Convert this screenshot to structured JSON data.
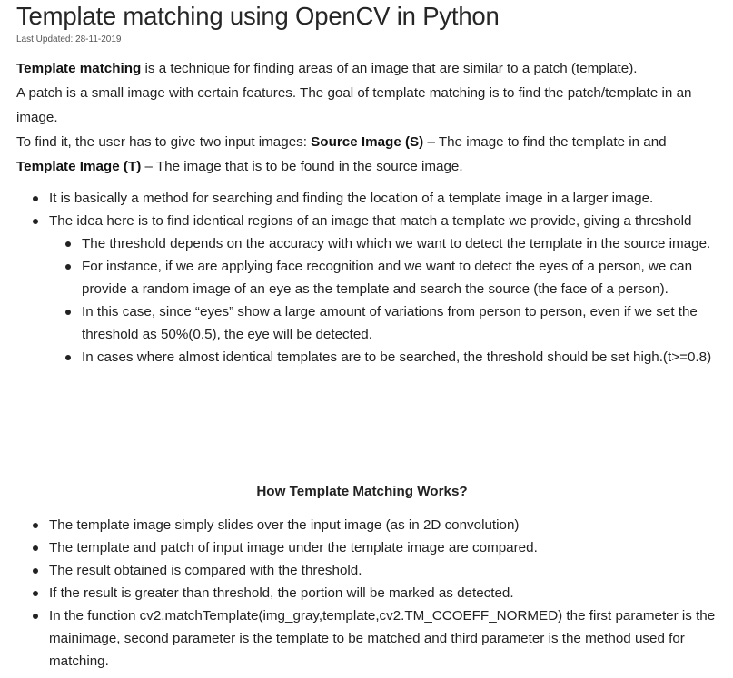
{
  "title": "Template matching using OpenCV in Python",
  "last_updated": "Last Updated: 28-11-2019",
  "intro": {
    "p1_bold": "Template matching",
    "p1_rest": " is a technique for finding areas of an image that are similar to a patch (template).",
    "p2": "A patch is a small image with certain features. The goal of template matching is to find the patch/template in an image.",
    "p3_a": "To find it, the user has to give two input images: ",
    "p3_bold1": "Source Image (S)",
    "p3_b": " – The image to find the template in and ",
    "p3_bold2": "Template Image (T)",
    "p3_c": " – The image that is to be found in the source image."
  },
  "bullets": [
    "It is basically a method for searching and finding the location of a template image in a larger image.",
    "The idea here is to find identical regions of an image that match a template we provide, giving a threshold"
  ],
  "sub_bullets": [
    "The threshold depends on the accuracy with which we want to detect the template in the source image.",
    "For instance, if we are applying face recognition and we want to detect the eyes of a person, we can provide a random image of an eye as the template and search the source (the face of a person).",
    "In this case, since “eyes” show a large amount of variations from person to person, even if we set the threshold as 50%(0.5), the eye will be detected.",
    "In cases where almost identical templates are to be searched, the threshold should be set high.(t>=0.8)"
  ],
  "section_heading": "How Template Matching Works?",
  "how_bullets": [
    "The template image simply slides over the input image (as in 2D convolution)",
    "The template and patch of input image under the template image are compared.",
    "The result obtained is compared with the threshold.",
    "If the result is greater than threshold, the portion will be marked as detected.",
    "In the function cv2.matchTemplate(img_gray,template,cv2.TM_CCOEFF_NORMED) the first parameter is the mainimage, second parameter is the template to be matched and third parameter is the method used for matching."
  ]
}
